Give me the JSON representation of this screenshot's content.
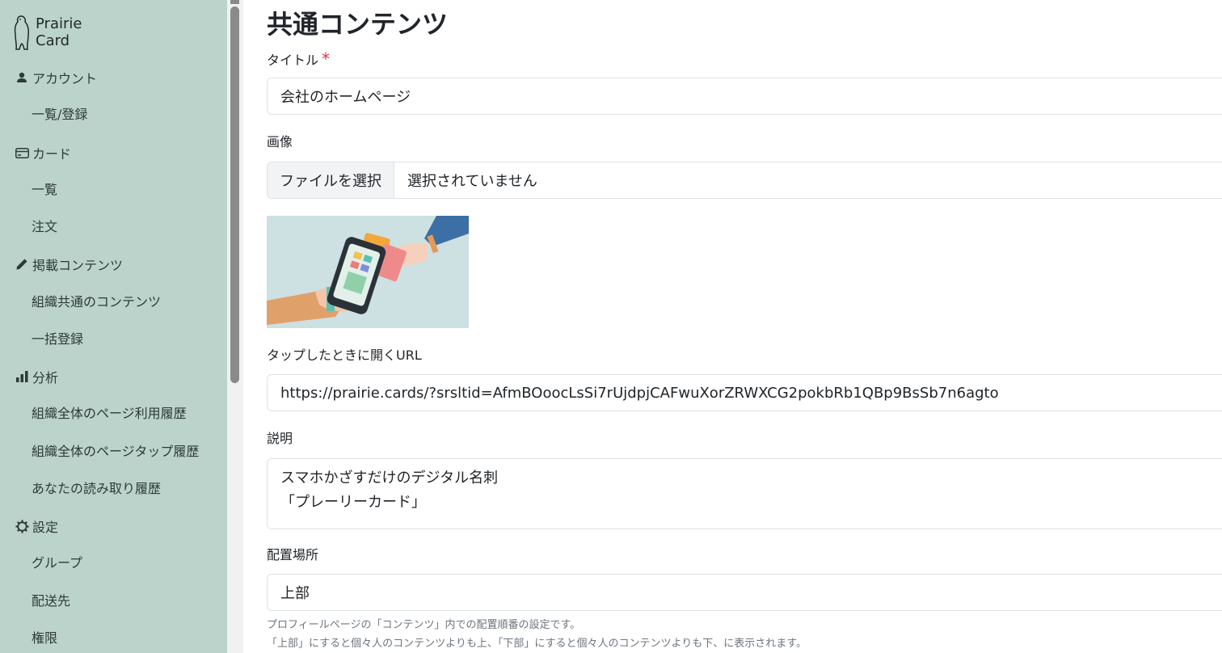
{
  "brand": {
    "line1": "Prairie",
    "line2": "Card"
  },
  "sidebar": {
    "sections": [
      {
        "label": "アカウント",
        "icon": "person-icon"
      },
      {
        "label": "カード",
        "icon": "card-icon"
      },
      {
        "label": "掲載コンテンツ",
        "icon": "pencil-icon"
      },
      {
        "label": "分析",
        "icon": "bar-chart-icon"
      },
      {
        "label": "設定",
        "icon": "gear-icon"
      }
    ],
    "items": {
      "account_list": "一覧/登録",
      "card_list": "一覧",
      "card_order": "注文",
      "content_common": "組織共通のコンテンツ",
      "content_bulk": "一括登録",
      "analytics_page_usage": "組織全体のページ利用履歴",
      "analytics_page_tap": "組織全体のページタップ履歴",
      "analytics_your_reads": "あなたの読み取り履歴",
      "settings_group": "グループ",
      "settings_delivery": "配送先",
      "settings_permission": "権限"
    }
  },
  "main": {
    "title": "共通コンテンツ",
    "title_label": "タイトル",
    "required_mark": "*",
    "title_value": "会社のホームページ",
    "image_label": "画像",
    "file_button": "ファイルを選択",
    "file_status": "選択されていません",
    "url_label": "タップしたときに開くURL",
    "url_value": "https://prairie.cards/?srsltid=AfmBOoocLsSi7rUjdpjCAFwuXorZRWXCG2pokbRb1QBp9BsSb7n6agto",
    "description_label": "説明",
    "description_line1": "スマホかざすだけのデジタル名刺",
    "description_line2": "「プレーリーカード」",
    "placement_label": "配置場所",
    "placement_value": "上部",
    "help_line1": "プロフィールページの「コンテンツ」内での配置順番の設定です。",
    "help_line2": "「上部」にすると個々人のコンテンツよりも上、「下部」にすると個々人のコンテンツよりも下、に表示されます。"
  },
  "colors": {
    "sidebar_bg": "#bcd3cc",
    "required": "#dc3545",
    "border": "#dee2e6"
  }
}
